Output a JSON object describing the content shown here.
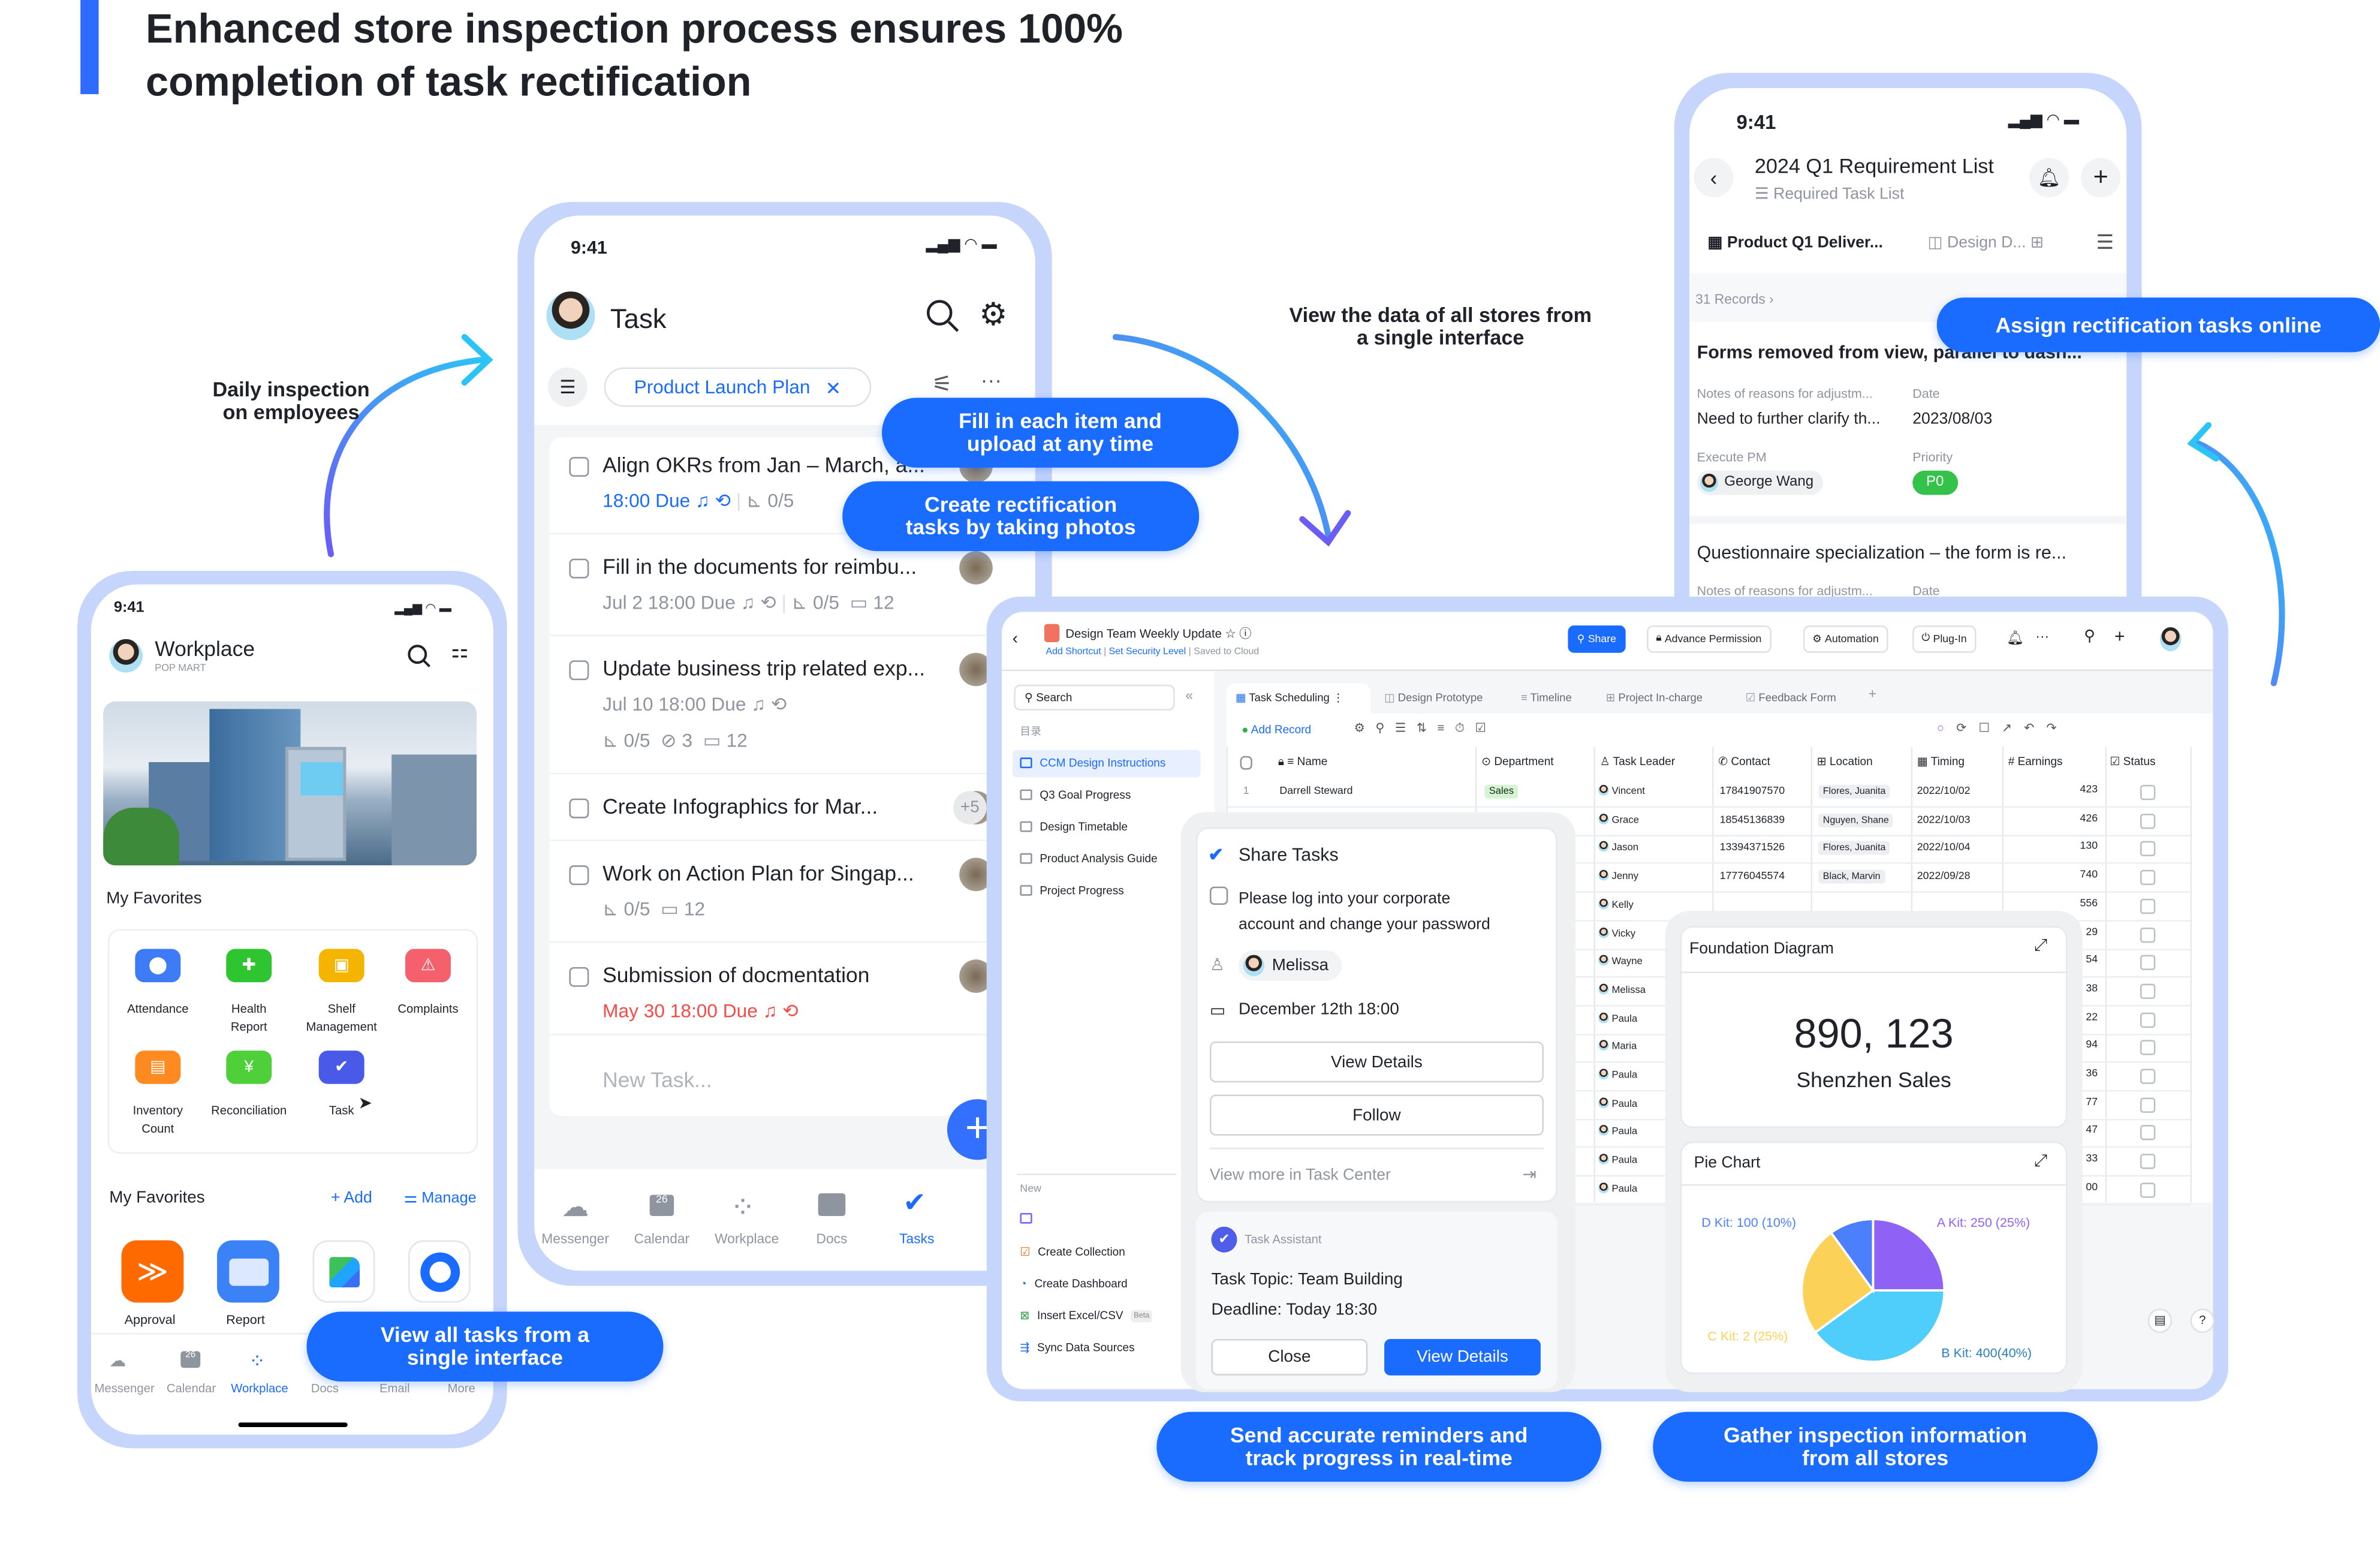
{
  "headline": {
    "line1": "Enhanced store inspection process ensures 100%",
    "line2": "completion of task rectification",
    "accent_color": "#2f6bff"
  },
  "annotations": {
    "daily_1": "Daily inspection",
    "daily_2": "on employees",
    "view_data_1": "View the data of all stores from",
    "view_data_2": "a single interface"
  },
  "callouts": {
    "fill_1": "Fill in each item and",
    "fill_2": "upload at any time",
    "create_1": "Create rectification",
    "create_2": "tasks by taking photos",
    "assign": "Assign rectification tasks online",
    "view_all_1": "View all tasks from a",
    "view_all_2": "single interface",
    "send_1": "Send accurate reminders and",
    "send_2": "track progress in real-time",
    "gather_1": "Gather inspection information",
    "gather_2": "from all stores",
    "color": "#1a6bff"
  },
  "workplace_phone": {
    "time": "9:41",
    "title": "Workplace",
    "org": "POP MART",
    "favorites_title": "My Favorites",
    "favorites": [
      {
        "label_1": "Attendance",
        "label_2": "",
        "icon": "location-pin-icon",
        "color": "#3d7bf7"
      },
      {
        "label_1": "Health",
        "label_2": "Report",
        "icon": "shield-plus-icon",
        "color": "#2fc531"
      },
      {
        "label_1": "Shelf",
        "label_2": "Management",
        "icon": "box-icon",
        "color": "#f5b400"
      },
      {
        "label_1": "Complaints",
        "label_2": "",
        "icon": "warning-icon",
        "color": "#f4606c"
      },
      {
        "label_1": "Inventory",
        "label_2": "Count",
        "icon": "boxes-icon",
        "color": "#ff8a1f"
      },
      {
        "label_1": "Reconciliation",
        "label_2": "",
        "icon": "yen-icon",
        "color": "#4fcf3a"
      },
      {
        "label_1": "Task",
        "label_2": "",
        "icon": "check-icon",
        "color": "#4a5ae8"
      }
    ],
    "favorites2_title": "My Favorites",
    "add_label": "Add",
    "manage_label": "Manage",
    "apps": [
      {
        "label": "Approval",
        "color": "#ff6a00"
      },
      {
        "label": "Report",
        "color": "#3b82f6"
      },
      {
        "label": "",
        "color": "#ffffff"
      },
      {
        "label": "",
        "color": "#ffffff"
      }
    ],
    "nav": [
      "Messenger",
      "Calendar",
      "Workplace",
      "Docs",
      "Email",
      "More"
    ],
    "nav_active": "Workplace",
    "calendar_day": "26"
  },
  "task_phone": {
    "time": "9:41",
    "title": "Task",
    "filter_chip": "Product Launch Plan",
    "tasks": [
      {
        "title": "Align OKRs from Jan – March, a...",
        "due": "18:00 Due",
        "due_color": "#1a6bff",
        "subtasks": "0/5"
      },
      {
        "title": "Fill in the documents for reimbu...",
        "due": "Jul 2 18:00 Due",
        "subtasks": "0/5",
        "comments": "12"
      },
      {
        "title": "Update business trip related exp...",
        "due": "Jul 10 18:00 Due",
        "subtasks": "0/5",
        "attachments": "3",
        "comments": "12"
      },
      {
        "title": "Create Infographics for Mar...",
        "extra_assignees": "+5"
      },
      {
        "title": "Work on Action Plan for Singap...",
        "subtasks": "0/5",
        "comments": "12"
      },
      {
        "title": "Submission of docmentation",
        "due": "May 30 18:00 Due",
        "due_color": "#f54a45"
      }
    ],
    "new_task_placeholder": "New Task...",
    "nav": [
      "Messenger",
      "Calendar",
      "Workplace",
      "Docs",
      "Tasks"
    ],
    "nav_active": "Tasks",
    "calendar_day": "26"
  },
  "requirement_phone": {
    "time": "9:41",
    "title": "2024 Q1 Requirement List",
    "subtitle": "Required Task List",
    "tab_active": "Product Q1 Deliver...",
    "tab_2": "Design D...",
    "records": "31 Records",
    "record_1": {
      "title": "Forms removed from view, parallel to dash...",
      "notes_label": "Notes of reasons for adjustm...",
      "notes_value": "Need to further clarify th...",
      "date_label": "Date",
      "date_value": "2023/08/03",
      "pm_label": "Execute PM",
      "pm_value": "George Wang",
      "priority_label": "Priority",
      "priority_value": "P0",
      "priority_color": "#34c24a"
    },
    "record_2": {
      "title": "Questionnaire specialization – the form is re...",
      "notes_label": "Notes of reasons for adjustm...",
      "date_label": "Date"
    }
  },
  "desktop": {
    "doc_title": "Design Team Weekly Update",
    "add_shortcut": "Add Shortcut",
    "security": "Set Security Level",
    "saved": "Saved to Cloud",
    "buttons": {
      "share": "Share",
      "permission": "Advance Permission",
      "automation": "Automation",
      "plugin": "Plug-In"
    },
    "sidebar": {
      "search_placeholder": "Search",
      "section": "目录",
      "items": [
        "CCM Design Instructions",
        "Q3 Goal Progress",
        "Design Timetable",
        "Product Analysis Guide",
        "Project Progress"
      ],
      "active": "CCM Design Instructions",
      "new_label": "New",
      "new_items": [
        "Create Collection",
        "Create Dashboard",
        "Insert Excel/CSV",
        "Sync Data Sources"
      ],
      "beta": "Beta"
    },
    "tabs": [
      "Task Scheduling",
      "Design Prototype",
      "Timeline",
      "Project In-charge",
      "Feedback Form"
    ],
    "add_record": "Add Record",
    "columns": [
      "Name",
      "Department",
      "Task Leader",
      "Contact",
      "Location",
      "Timing",
      "Earnings",
      "Status"
    ],
    "rows": [
      {
        "no": "1",
        "name": "Darrell Steward",
        "dept": "Sales",
        "leader": "Vincent",
        "contact": "17841907570",
        "location": "Flores, Juanita",
        "timing": "2022/10/02",
        "earnings": "423"
      },
      {
        "leader": "Grace",
        "contact": "18545136839",
        "location": "Nguyen, Shane",
        "timing": "2022/10/03",
        "earnings": "426"
      },
      {
        "leader": "Jason",
        "contact": "13394371526",
        "location": "Flores, Juanita",
        "timing": "2022/10/04",
        "earnings": "130"
      },
      {
        "leader": "Jenny",
        "contact": "17776045574",
        "location": "Black, Marvin",
        "timing": "2022/09/28",
        "earnings": "740"
      },
      {
        "leader": "Kelly",
        "earnings": "556"
      },
      {
        "leader": "Vicky",
        "earnings": "29"
      },
      {
        "leader": "Wayne",
        "earnings": "54"
      },
      {
        "leader": "Melissa",
        "earnings": "38"
      },
      {
        "leader": "Paula",
        "earnings": "22"
      },
      {
        "leader": "Maria",
        "earnings": "94"
      },
      {
        "leader": "Paula",
        "earnings": "36"
      },
      {
        "leader": "Paula",
        "earnings": "77"
      },
      {
        "leader": "Paula",
        "earnings": "47"
      },
      {
        "leader": "Paula",
        "earnings": "33"
      },
      {
        "leader": "Paula",
        "earnings": "00"
      }
    ]
  },
  "share_card": {
    "title": "Share Tasks",
    "task": "Please log into your corporate",
    "task_2": "account and change your password",
    "assignee": "Melissa",
    "date": "December 12th 18:00",
    "view_details": "View Details",
    "follow": "Follow",
    "view_more": "View more in Task Center",
    "assistant": "Task Assistant",
    "topic": "Task Topic: Team Building",
    "deadline": "Deadline: Today 18:30",
    "close": "Close",
    "view_details_2": "View Details"
  },
  "dashboard": {
    "foundation_title": "Foundation Diagram",
    "big_number": "890, 123",
    "big_label": "Shenzhen Sales",
    "pie_title": "Pie Chart"
  },
  "chart_data": {
    "type": "pie",
    "title": "Pie Chart",
    "slices": [
      {
        "name": "A Kit",
        "value": 250,
        "percent": 25,
        "label": "A Kit: 250 (25%)",
        "color": "#9061f5"
      },
      {
        "name": "B Kit",
        "value": 400,
        "percent": 40,
        "label": "B Kit: 400(40%)",
        "color": "#4fcdfb"
      },
      {
        "name": "C Kit",
        "value": 2,
        "percent": 25,
        "label": "C Kit: 2 (25%)",
        "color": "#fcd157"
      },
      {
        "name": "D Kit",
        "value": 100,
        "percent": 10,
        "label": "D Kit: 100 (10%)",
        "color": "#4c7ffb"
      }
    ],
    "legend": "none"
  }
}
